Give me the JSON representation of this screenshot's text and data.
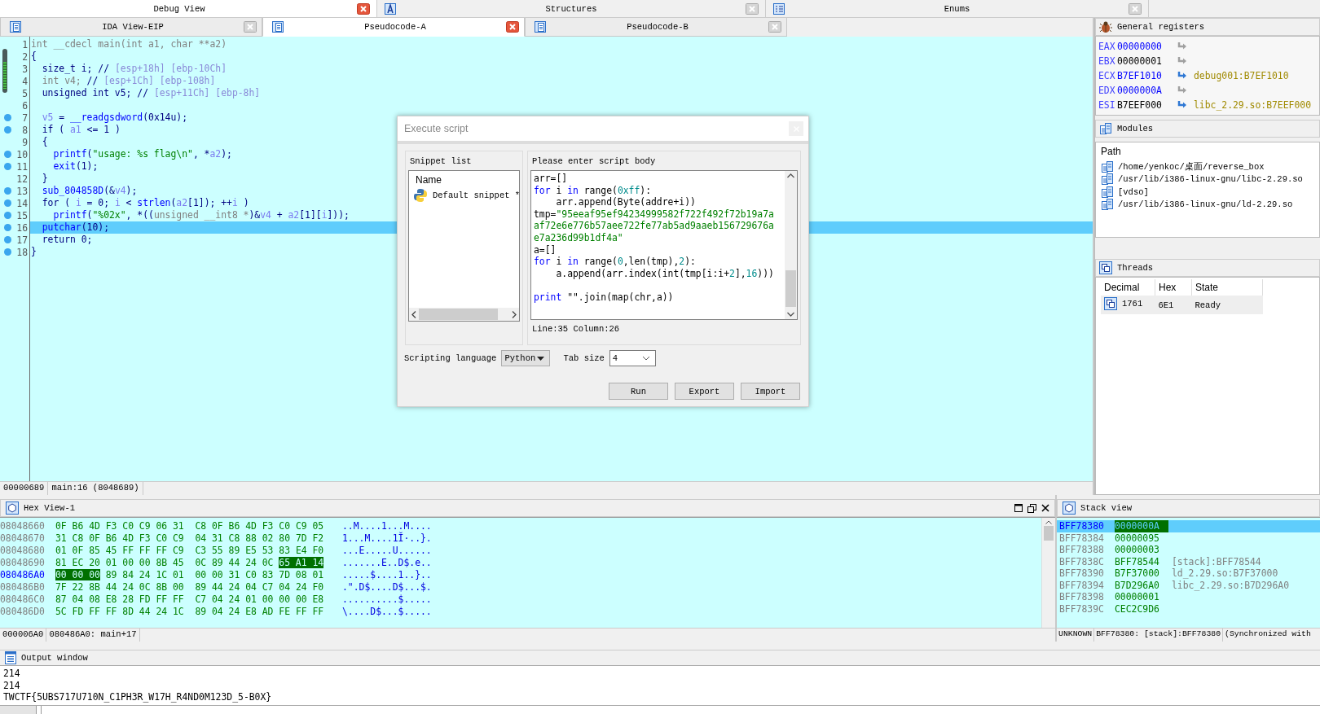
{
  "top_tabs": [
    {
      "label": "Debug View",
      "kind": "plain",
      "selected": true
    },
    {
      "label": "Structures",
      "kind": "struct",
      "selected": false
    },
    {
      "label": "Enums",
      "kind": "enum",
      "selected": false
    }
  ],
  "debug_view": {
    "tabs": [
      {
        "label": "IDA View-EIP",
        "selected": false
      },
      {
        "label": "Pseudocode-A",
        "selected": true
      },
      {
        "label": "Pseudocode-B",
        "selected": false
      }
    ],
    "code_lines": [
      {
        "number": "1",
        "breakpoint": false,
        "current": false,
        "tokens": [
          {
            "kind": "dim",
            "text": "int __cdecl main(int a1, char **a2)"
          }
        ]
      },
      {
        "number": "2",
        "breakpoint": false,
        "current": false,
        "tokens": [
          {
            "kind": "plain",
            "text": "{"
          }
        ]
      },
      {
        "number": "3",
        "breakpoint": false,
        "current": false,
        "tokens": [
          {
            "kind": "plain",
            "text": "  size_t i; // "
          },
          {
            "kind": "note",
            "text": "[esp+18h] [ebp-10Ch]"
          }
        ]
      },
      {
        "number": "4",
        "breakpoint": false,
        "current": false,
        "tokens": [
          {
            "kind": "dim",
            "text": "  int v4; "
          },
          {
            "kind": "plain",
            "text": "// "
          },
          {
            "kind": "note",
            "text": "[esp+1Ch] [ebp-108h]"
          }
        ]
      },
      {
        "number": "5",
        "breakpoint": false,
        "current": false,
        "tokens": [
          {
            "kind": "plain",
            "text": "  unsigned int v5; // "
          },
          {
            "kind": "note",
            "text": "[esp+11Ch] [ebp-8h]"
          }
        ]
      },
      {
        "number": "6",
        "breakpoint": false,
        "current": false
      },
      {
        "number": "7",
        "breakpoint": true,
        "current": false,
        "tokens": [
          {
            "kind": "var",
            "text": "  v5"
          },
          {
            "kind": "plain",
            "text": " = "
          },
          {
            "kind": "func",
            "text": "__readgsdword"
          },
          {
            "kind": "plain",
            "text": "(0x14u);"
          }
        ]
      },
      {
        "number": "8",
        "breakpoint": true,
        "current": false,
        "tokens": [
          {
            "kind": "plain",
            "text": "  if ( "
          },
          {
            "kind": "var",
            "text": "a1"
          },
          {
            "kind": "plain",
            "text": " <= 1 )"
          }
        ]
      },
      {
        "number": "9",
        "breakpoint": false,
        "current": false,
        "tokens": [
          {
            "kind": "plain",
            "text": "  {"
          }
        ]
      },
      {
        "number": "10",
        "breakpoint": true,
        "current": false,
        "tokens": [
          {
            "kind": "func",
            "text": "    printf"
          },
          {
            "kind": "plain",
            "text": "("
          },
          {
            "kind": "str",
            "text": "\"usage: %s flag\\n\""
          },
          {
            "kind": "plain",
            "text": ", *"
          },
          {
            "kind": "var",
            "text": "a2"
          },
          {
            "kind": "plain",
            "text": ");"
          }
        ]
      },
      {
        "number": "11",
        "breakpoint": true,
        "current": false,
        "tokens": [
          {
            "kind": "func",
            "text": "    exit"
          },
          {
            "kind": "plain",
            "text": "(1);"
          }
        ]
      },
      {
        "number": "12",
        "breakpoint": false,
        "current": false,
        "tokens": [
          {
            "kind": "plain",
            "text": "  }"
          }
        ]
      },
      {
        "number": "13",
        "breakpoint": true,
        "current": false,
        "tokens": [
          {
            "kind": "func",
            "text": "  sub_804858D"
          },
          {
            "kind": "plain",
            "text": "(&"
          },
          {
            "kind": "var",
            "text": "v4"
          },
          {
            "kind": "plain",
            "text": ");"
          }
        ]
      },
      {
        "number": "14",
        "breakpoint": true,
        "current": false,
        "tokens": [
          {
            "kind": "plain",
            "text": "  for ( "
          },
          {
            "kind": "var",
            "text": "i"
          },
          {
            "kind": "plain",
            "text": " = 0; "
          },
          {
            "kind": "var",
            "text": "i"
          },
          {
            "kind": "plain",
            "text": " < "
          },
          {
            "kind": "func",
            "text": "strlen"
          },
          {
            "kind": "plain",
            "text": "("
          },
          {
            "kind": "var",
            "text": "a2"
          },
          {
            "kind": "plain",
            "text": "[1]); ++"
          },
          {
            "kind": "var",
            "text": "i"
          },
          {
            "kind": "plain",
            "text": " )"
          }
        ]
      },
      {
        "number": "15",
        "breakpoint": true,
        "current": false,
        "tokens": [
          {
            "kind": "func",
            "text": "    printf"
          },
          {
            "kind": "plain",
            "text": "("
          },
          {
            "kind": "str",
            "text": "\"%02x\""
          },
          {
            "kind": "plain",
            "text": ", *(("
          },
          {
            "kind": "dim",
            "text": "unsigned __int8 *"
          },
          {
            "kind": "plain",
            "text": ")&"
          },
          {
            "kind": "var",
            "text": "v4"
          },
          {
            "kind": "plain",
            "text": " + "
          },
          {
            "kind": "var",
            "text": "a2"
          },
          {
            "kind": "plain",
            "text": "[1]["
          },
          {
            "kind": "var",
            "text": "i"
          },
          {
            "kind": "plain",
            "text": "]));"
          }
        ]
      },
      {
        "number": "16",
        "breakpoint": true,
        "current": true,
        "tokens": [
          {
            "kind": "func",
            "text": "  putchar"
          },
          {
            "kind": "plain",
            "text": "(10);"
          }
        ]
      },
      {
        "number": "17",
        "breakpoint": true,
        "current": false,
        "tokens": [
          {
            "kind": "plain",
            "text": "  return 0;"
          }
        ]
      },
      {
        "number": "18",
        "breakpoint": true,
        "current": false,
        "tokens": [
          {
            "kind": "plain",
            "text": "}"
          }
        ]
      }
    ],
    "status": [
      "00000689",
      "main:16 (8048689)"
    ]
  },
  "dialog": {
    "title": "Execute script",
    "snippet_list": {
      "title": "Snippet list",
      "column": "Name",
      "items": [
        {
          "label": "Default snippet *",
          "selected": false
        }
      ]
    },
    "script": {
      "title": "Please enter script body",
      "lines": [
        {
          "tokens": [
            {
              "kind": "plain",
              "text": "arr=[]"
            }
          ]
        },
        {
          "tokens": [
            {
              "kind": "kw",
              "text": "for"
            },
            {
              "kind": "plain",
              "text": " i "
            },
            {
              "kind": "kw",
              "text": "in"
            },
            {
              "kind": "plain",
              "text": " range("
            },
            {
              "kind": "num",
              "text": "0xff"
            },
            {
              "kind": "plain",
              "text": "):"
            }
          ]
        },
        {
          "tokens": [
            {
              "kind": "plain",
              "text": "    arr.append(Byte(addre+i))"
            }
          ]
        },
        {
          "tokens": [
            {
              "kind": "plain",
              "text": "tmp="
            },
            {
              "kind": "str",
              "text": "\"95eeaf95ef94234999582f722f492f72b19a7a"
            }
          ]
        },
        {
          "tokens": [
            {
              "kind": "str",
              "text": "af72e6e776b57aee722fe77ab5ad9aaeb156729676a"
            }
          ]
        },
        {
          "tokens": [
            {
              "kind": "str",
              "text": "e7a236d99b1df4a\""
            }
          ]
        },
        {
          "tokens": [
            {
              "kind": "plain",
              "text": "a=[]"
            }
          ]
        },
        {
          "tokens": [
            {
              "kind": "kw",
              "text": "for"
            },
            {
              "kind": "plain",
              "text": " i "
            },
            {
              "kind": "kw",
              "text": "in"
            },
            {
              "kind": "plain",
              "text": " range("
            },
            {
              "kind": "num",
              "text": "0"
            },
            {
              "kind": "plain",
              "text": ",len(tmp),"
            },
            {
              "kind": "num",
              "text": "2"
            },
            {
              "kind": "plain",
              "text": "):"
            }
          ]
        },
        {
          "tokens": [
            {
              "kind": "plain",
              "text": "    a.append(arr.index(int(tmp[i:i+"
            },
            {
              "kind": "num",
              "text": "2"
            },
            {
              "kind": "plain",
              "text": "],"
            },
            {
              "kind": "num",
              "text": "16"
            },
            {
              "kind": "plain",
              "text": ")))"
            }
          ]
        },
        {
          "blank": true
        },
        {
          "tokens": [
            {
              "kind": "kw",
              "text": "print"
            },
            {
              "kind": "plain",
              "text": " \"\".join(map(chr,a))"
            }
          ]
        }
      ],
      "position": "Line:35 Column:26"
    },
    "language": {
      "label": "Scripting language",
      "value": "Python"
    },
    "tab_size": {
      "label": "Tab size",
      "value": "4"
    },
    "buttons": [
      "Run",
      "Export",
      "Import"
    ]
  },
  "registers": {
    "title": "General registers",
    "rows": [
      {
        "name": "EAX",
        "value": "00000000",
        "changed": true
      },
      {
        "name": "EBX",
        "value": "00000001",
        "changed": false
      },
      {
        "name": "ECX",
        "value": "B7EF1010",
        "changed": true,
        "target": "debug001:B7EF1010"
      },
      {
        "name": "EDX",
        "value": "0000000A",
        "changed": true
      },
      {
        "name": "ESI",
        "value": "B7EEF000",
        "changed": false,
        "target": "libc_2.29.so:B7EEF000"
      }
    ]
  },
  "modules": {
    "title": "Modules",
    "column": "Path",
    "items": [
      "/home/yenkoc/桌面/reverse_box",
      "/usr/lib/i386-linux-gnu/libc-2.29.so",
      "[vdso]",
      "/usr/lib/i386-linux-gnu/ld-2.29.so"
    ]
  },
  "threads": {
    "title": "Threads",
    "columns": [
      "Decimal",
      "Hex",
      "State"
    ],
    "rows": [
      [
        "1761",
        "6E1",
        "Ready"
      ]
    ]
  },
  "hex_view": {
    "title": "Hex View-1",
    "rows": [
      {
        "address": "08048660",
        "current": false,
        "bytes": [
          {
            "text": "0F B6 4D F3 C0 C9 06 31  C8 0F B6 4D F3 C0 C9 05",
            "selected": false
          }
        ],
        "ascii": "..M....1...M...."
      },
      {
        "address": "08048670",
        "current": false,
        "bytes": [
          {
            "text": "31 C8 0F B6 4D F3 C0 C9  04 31 C8 88 02 80 7D F2",
            "selected": false
          }
        ],
        "ascii": "1...M....1Ĭ·..}."
      },
      {
        "address": "08048680",
        "current": false,
        "bytes": [
          {
            "text": "01 0F 85 45 FF FF FF C9  C3 55 89 E5 53 83 E4 F0",
            "selected": false
          }
        ],
        "ascii": "...E.....U......"
      },
      {
        "address": "08048690",
        "current": false,
        "bytes": [
          {
            "text": "81 EC 20 01 00 00 8B 45  0C 89 44 24 0C",
            "selected": false
          },
          {
            "text": "65 A1 14",
            "selected": true
          }
        ],
        "ascii": ".......E..D$.e.."
      },
      {
        "address": "080486A0",
        "current": true,
        "bytes": [
          {
            "text": "00 00 00",
            "selected": true
          },
          {
            "text": "89 84 24 1C 01  00 00 31 C0 83 7D 08 01",
            "selected": false
          }
        ],
        "ascii": ".....$....1..}.."
      },
      {
        "address": "080486B0",
        "current": false,
        "bytes": [
          {
            "text": "7F 22 8B 44 24 0C 8B 00  89 44 24 04 C7 04 24 F0",
            "selected": false
          }
        ],
        "ascii": ".\".D$....D$...$."
      },
      {
        "address": "080486C0",
        "current": false,
        "bytes": [
          {
            "text": "87 04 08 E8 28 FD FF FF  C7 04 24 01 00 00 00 E8",
            "selected": false
          }
        ],
        "ascii": "..........$....."
      },
      {
        "address": "080486D0",
        "current": false,
        "bytes": [
          {
            "text": "5C FD FF FF 8D 44 24 1C  89 04 24 E8 AD FE FF FF",
            "selected": false
          }
        ],
        "ascii": "\\....D$...$....."
      }
    ],
    "status": [
      "000006A0",
      "080486A0: main+17"
    ]
  },
  "stack_view": {
    "title": "Stack view",
    "rows": [
      {
        "address": "BFF78380",
        "value": "0000000A",
        "selected": true
      },
      {
        "address": "BFF78384",
        "value": "00000095",
        "selected": false
      },
      {
        "address": "BFF78388",
        "value": "00000003",
        "selected": false
      },
      {
        "address": "BFF7838C",
        "value": "BFF78544",
        "comment": "[stack]:BFF78544",
        "selected": false
      },
      {
        "address": "BFF78390",
        "value": "B7F37000",
        "comment": "ld_2.29.so:B7F37000",
        "selected": false
      },
      {
        "address": "BFF78394",
        "value": "B7D296A0",
        "comment": "libc_2.29.so:B7D296A0",
        "selected": false
      },
      {
        "address": "BFF78398",
        "value": "00000001",
        "selected": false
      },
      {
        "address": "BFF7839C",
        "value": "CEC2C9D6",
        "selected": false
      }
    ],
    "status": [
      "UNKNOWN",
      "BFF78380: [stack]:BFF78380",
      "(Synchronized with"
    ]
  },
  "output": {
    "title": "Output window",
    "lines": [
      "214",
      "214",
      "TWCTF{5UBS717U710N_C1PH3R_W17H_R4ND0M123D_5-B0X}"
    ]
  }
}
